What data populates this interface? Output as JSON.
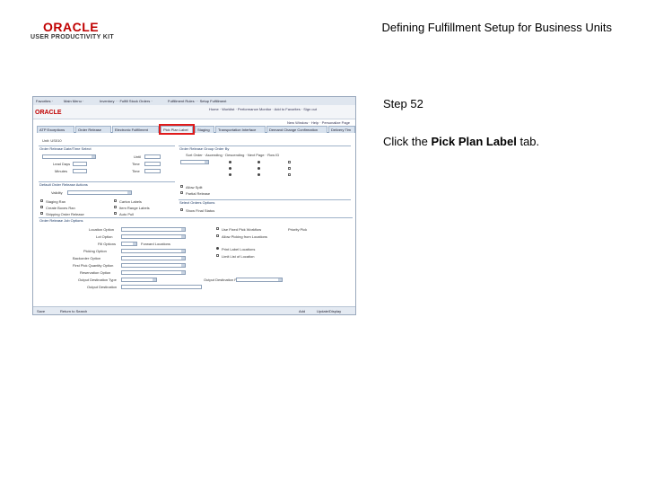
{
  "header": {
    "logo_word": "ORACLE",
    "logo_sub": "USER PRODUCTIVITY KIT",
    "title": "Defining Fulfillment Setup for Business Units"
  },
  "instructions": {
    "step": "Step 52",
    "text_before": "Click the ",
    "target": "Pick Plan Label",
    "text_after": " tab."
  },
  "screenshot": {
    "mini_logo": "ORACLE",
    "tabs": [
      {
        "label": "ATP Exceptions",
        "highlight": false
      },
      {
        "label": "Order Release",
        "highlight": false
      },
      {
        "label": "Electronic Fulfillment",
        "highlight": false
      },
      {
        "label": "Pick Plan Label",
        "highlight": true
      },
      {
        "label": "Staging",
        "highlight": false
      },
      {
        "label": "Transportation Interface",
        "highlight": false
      },
      {
        "label": "Demand Change Confirmation",
        "highlight": false
      },
      {
        "label": "Delivery Tim",
        "highlight": false
      }
    ],
    "footer": {
      "save": "Save",
      "return": "Return to Search",
      "add": "Add",
      "update": "Update/Display"
    },
    "accent": "#e01b1b"
  }
}
